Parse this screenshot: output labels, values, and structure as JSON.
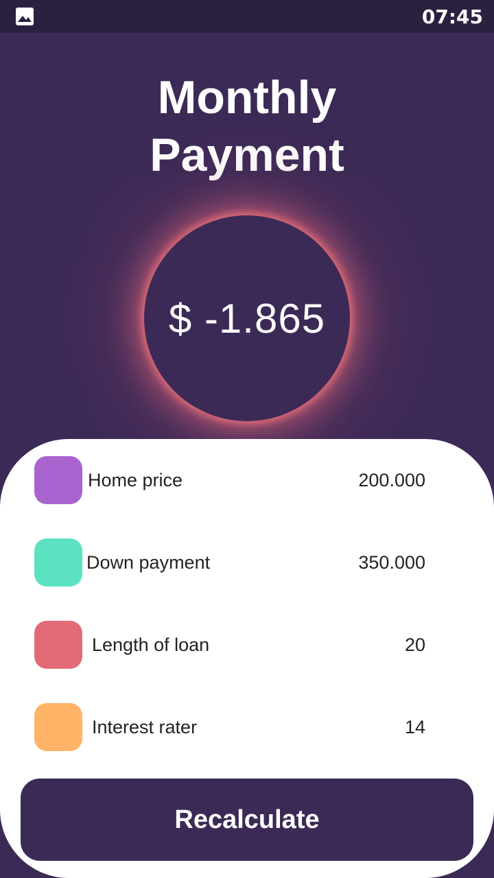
{
  "status_bar": {
    "time": "07:45",
    "left_icon": "gallery-icon"
  },
  "header": {
    "title_line1": "Monthly",
    "title_line2": "Payment"
  },
  "payment": {
    "value": "$ -1.865"
  },
  "fields": [
    {
      "label": "Home price",
      "value": "200.000",
      "color": "#a963cf"
    },
    {
      "label": "Down payment",
      "value": "350.000",
      "color": "#5ce1c1"
    },
    {
      "label": "Length of loan",
      "value": "20",
      "color": "#e36b78"
    },
    {
      "label": "Interest rater",
      "value": "14",
      "color": "#ffb467"
    }
  ],
  "actions": {
    "recalculate_label": "Recalculate"
  },
  "colors": {
    "background": "#3c2a56",
    "status_bar": "#2c2040",
    "card": "#ffffff",
    "glow": "#e87078"
  }
}
